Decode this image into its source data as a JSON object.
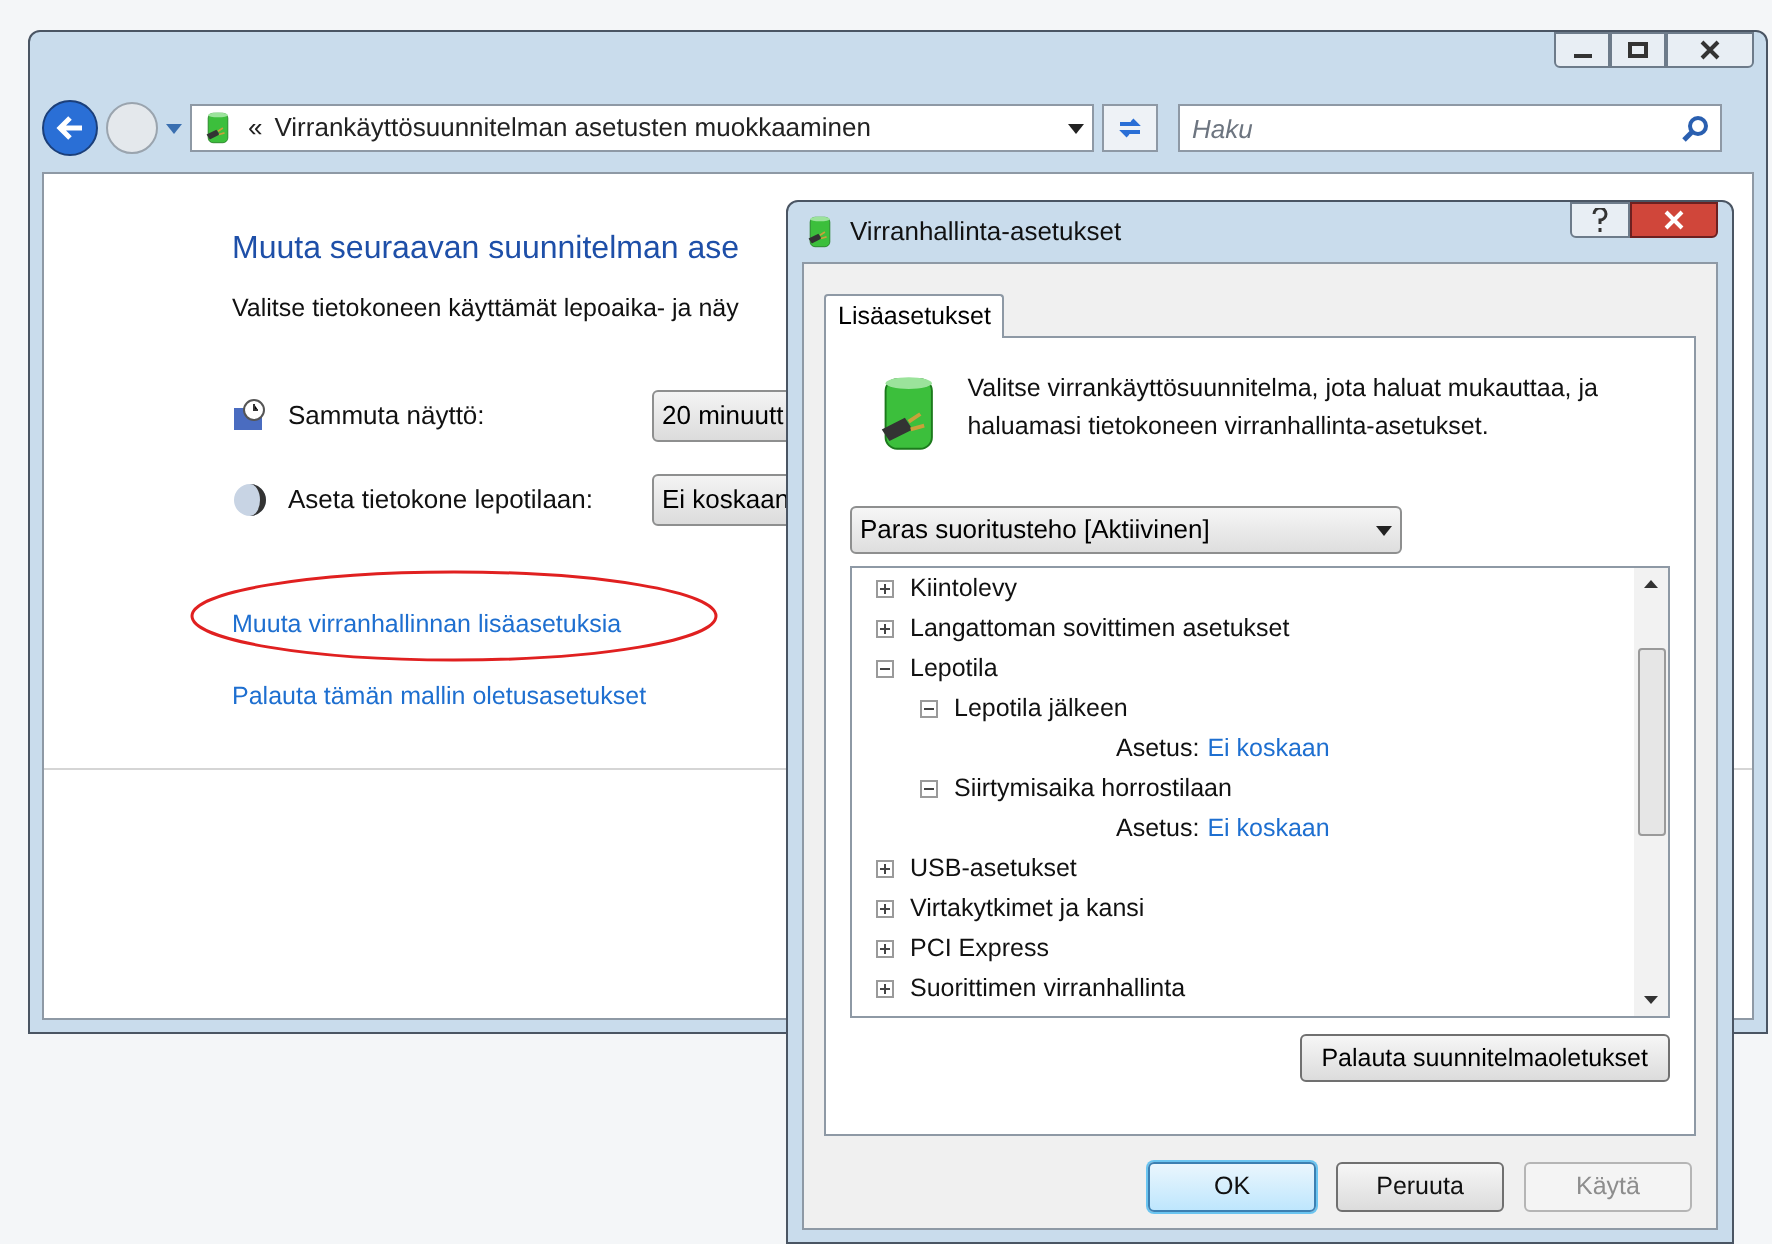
{
  "main_window": {
    "address": {
      "path_prefix": "«",
      "path": "Virrankäyttösuunnitelman asetusten muokkaaminen"
    },
    "search": {
      "placeholder": "Haku"
    },
    "heading": "Muuta seuraavan suunnitelman ase",
    "subheading": "Valitse tietokoneen käyttämät lepoaika- ja näy",
    "settings": [
      {
        "kind": "display",
        "label": "Sammuta näyttö:",
        "value": "20 minuutt"
      },
      {
        "kind": "sleep",
        "label": "Aseta tietokone lepotilaan:",
        "value": "Ei koskaan"
      }
    ],
    "links": [
      {
        "label": "Muuta virranhallinnan lisäasetuksia",
        "highlighted": true
      },
      {
        "label": "Palauta tämän mallin oletusasetukset",
        "highlighted": false
      }
    ]
  },
  "dialog": {
    "title": "Virranhallinta-asetukset",
    "tabs": [
      {
        "label": "Lisäasetukset",
        "selected": true
      }
    ],
    "description": "Valitse virrankäyttösuunnitelma, jota haluat mukauttaa, ja haluamasi tietokoneen virranhallinta-asetukset.",
    "plan": "Paras suoritusteho [Aktiivinen]",
    "tree": [
      {
        "label": "Kiintolevy",
        "expanded": false
      },
      {
        "label": "Langattoman sovittimen asetukset",
        "expanded": false
      },
      {
        "label": "Lepotila",
        "expanded": true,
        "children": [
          {
            "label": "Lepotila jälkeen",
            "expanded": true,
            "children": [
              {
                "kind": "setting",
                "label": "Asetus:",
                "value": "Ei koskaan"
              }
            ]
          },
          {
            "label": "Siirtymisaika horrostilaan",
            "expanded": true,
            "children": [
              {
                "kind": "setting",
                "label": "Asetus:",
                "value": "Ei koskaan"
              }
            ]
          }
        ]
      },
      {
        "label": "USB-asetukset",
        "expanded": false
      },
      {
        "label": "Virtakytkimet ja kansi",
        "expanded": false
      },
      {
        "label": "PCI Express",
        "expanded": false
      },
      {
        "label": "Suorittimen virranhallinta",
        "expanded": false
      }
    ],
    "restore_button": "Palauta suunnitelmaoletukset",
    "buttons": [
      {
        "label": "OK",
        "default": true,
        "disabled": false
      },
      {
        "label": "Peruuta",
        "default": false,
        "disabled": false
      },
      {
        "label": "Käytä",
        "default": false,
        "disabled": true
      }
    ]
  }
}
